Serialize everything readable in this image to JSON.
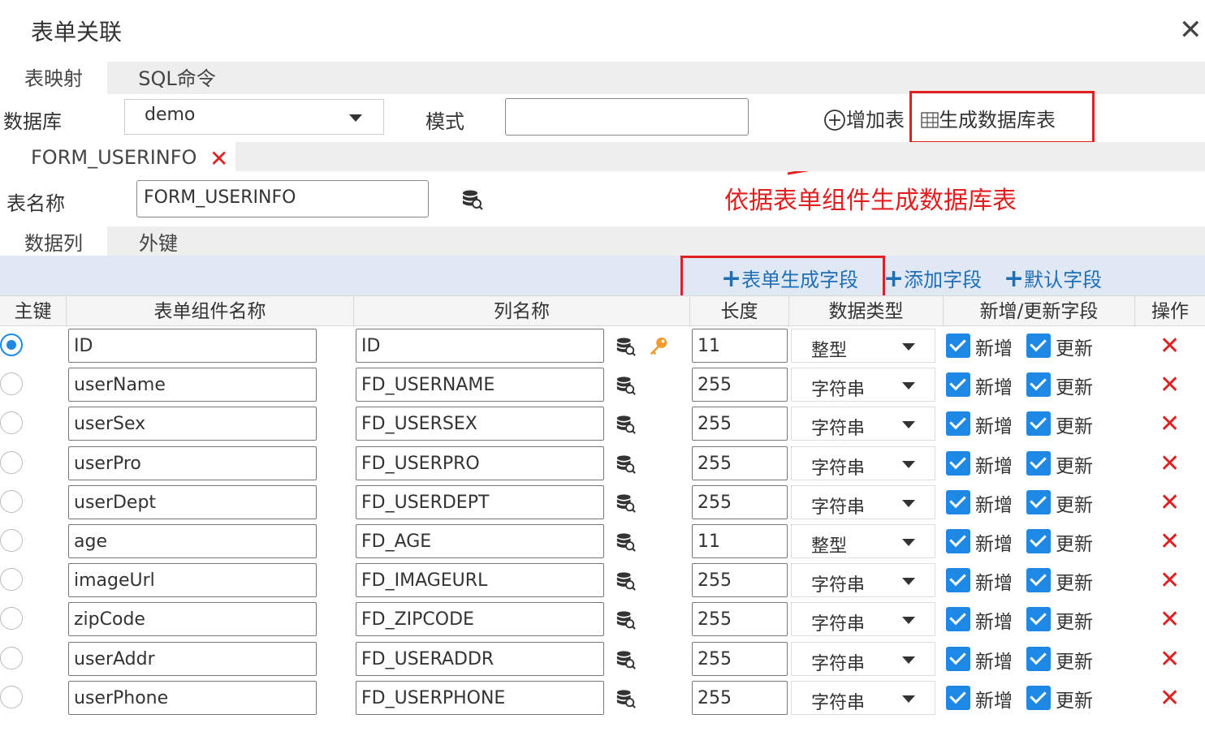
{
  "dialog": {
    "title": "表单关联"
  },
  "top_tabs": [
    {
      "label": "表映射"
    },
    {
      "label": "SQL命令"
    }
  ],
  "database": {
    "label": "数据库",
    "value": "demo"
  },
  "mode": {
    "label": "模式",
    "value": ""
  },
  "actions": {
    "add_table": "增加表",
    "generate_db_table": "生成数据库表"
  },
  "table_tab": {
    "label": "FORM_USERINFO"
  },
  "table_name": {
    "label": "表名称",
    "value": "FORM_USERINFO"
  },
  "annotation": "依据表单组件生成数据库表",
  "sub_tabs": [
    {
      "label": "数据列"
    },
    {
      "label": "外键"
    }
  ],
  "toolbar": {
    "form_fields": "表单生成字段",
    "add_field": "添加字段",
    "default_field": "默认字段"
  },
  "columns": [
    "主键",
    "表单组件名称",
    "列名称",
    "长度",
    "数据类型",
    "新增/更新字段",
    "操作"
  ],
  "checkbox_labels": {
    "insert": "新增",
    "update": "更新"
  },
  "rows": [
    {
      "pk": true,
      "component": "ID",
      "column": "ID",
      "length": "11",
      "type": "整型"
    },
    {
      "pk": false,
      "component": "userName",
      "column": "FD_USERNAME",
      "length": "255",
      "type": "字符串"
    },
    {
      "pk": false,
      "component": "userSex",
      "column": "FD_USERSEX",
      "length": "255",
      "type": "字符串"
    },
    {
      "pk": false,
      "component": "userPro",
      "column": "FD_USERPRO",
      "length": "255",
      "type": "字符串"
    },
    {
      "pk": false,
      "component": "userDept",
      "column": "FD_USERDEPT",
      "length": "255",
      "type": "字符串"
    },
    {
      "pk": false,
      "component": "age",
      "column": "FD_AGE",
      "length": "11",
      "type": "整型"
    },
    {
      "pk": false,
      "component": "imageUrl",
      "column": "FD_IMAGEURL",
      "length": "255",
      "type": "字符串"
    },
    {
      "pk": false,
      "component": "zipCode",
      "column": "FD_ZIPCODE",
      "length": "255",
      "type": "字符串"
    },
    {
      "pk": false,
      "component": "userAddr",
      "column": "FD_USERADDR",
      "length": "255",
      "type": "字符串"
    },
    {
      "pk": false,
      "component": "userPhone",
      "column": "FD_USERPHONE",
      "length": "255",
      "type": "字符串"
    }
  ],
  "colors": {
    "accent": "#1e88e5",
    "link": "#1e6fb8",
    "danger": "#e02020",
    "toolbar_bg": "#dfe8f3"
  },
  "icons": {
    "close": "close-icon",
    "db_search": "database-search-icon",
    "key": "key-icon",
    "plus": "plus-icon",
    "table": "table-icon",
    "delete": "delete-icon"
  }
}
